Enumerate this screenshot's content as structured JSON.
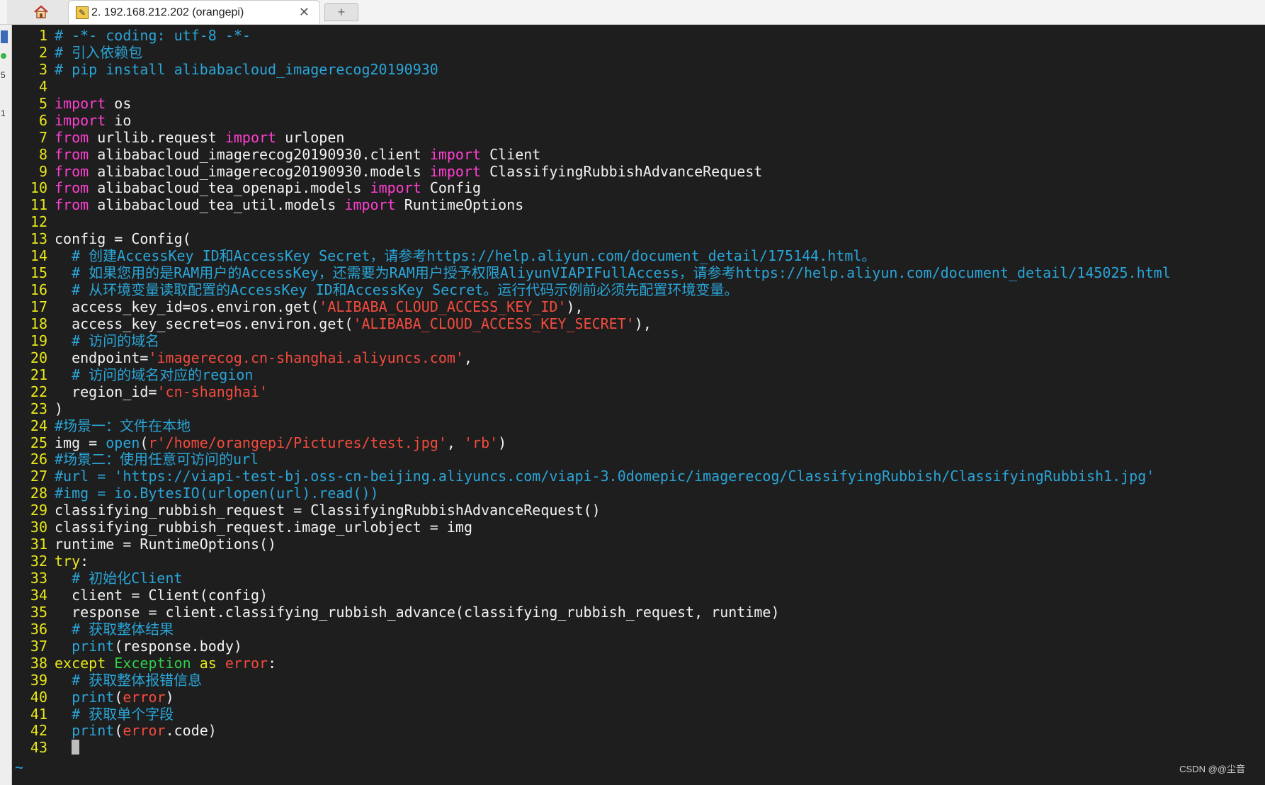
{
  "window": {
    "tab_home_icon": "home-icon",
    "tab_title": "2. 192.168.212.202 (orangepi)",
    "tab_close": "✕",
    "new_tab": "+"
  },
  "left_strip_marks": [
    "",
    "",
    "5",
    "1"
  ],
  "editor": {
    "tilde": "~",
    "watermark": "CSDN @@尘音"
  },
  "code_lines": [
    [
      {
        "t": "# -*- coding: utf-8 -*-",
        "c": "cm"
      }
    ],
    [
      {
        "t": "# 引入依赖包",
        "c": "cm"
      }
    ],
    [
      {
        "t": "# pip install alibabacloud_imagerecog20190930",
        "c": "cm"
      }
    ],
    [],
    [
      {
        "t": "import",
        "c": "kw"
      },
      {
        "t": " os"
      }
    ],
    [
      {
        "t": "import",
        "c": "kw"
      },
      {
        "t": " io"
      }
    ],
    [
      {
        "t": "from",
        "c": "kw"
      },
      {
        "t": " urllib.request "
      },
      {
        "t": "import",
        "c": "kw"
      },
      {
        "t": " urlopen"
      }
    ],
    [
      {
        "t": "from",
        "c": "kw"
      },
      {
        "t": " alibabacloud_imagerecog20190930.client "
      },
      {
        "t": "import",
        "c": "kw"
      },
      {
        "t": " Client"
      }
    ],
    [
      {
        "t": "from",
        "c": "kw"
      },
      {
        "t": " alibabacloud_imagerecog20190930.models "
      },
      {
        "t": "import",
        "c": "kw"
      },
      {
        "t": " ClassifyingRubbishAdvanceRequest"
      }
    ],
    [
      {
        "t": "from",
        "c": "kw"
      },
      {
        "t": " alibabacloud_tea_openapi.models "
      },
      {
        "t": "import",
        "c": "kw"
      },
      {
        "t": " Config"
      }
    ],
    [
      {
        "t": "from",
        "c": "kw"
      },
      {
        "t": " alibabacloud_tea_util.models "
      },
      {
        "t": "import",
        "c": "kw"
      },
      {
        "t": " RuntimeOptions"
      }
    ],
    [],
    [
      {
        "t": "config = Config("
      }
    ],
    [
      {
        "t": "  "
      },
      {
        "t": "# 创建AccessKey ID和AccessKey Secret，请参考https://help.aliyun.com/document_detail/175144.html。",
        "c": "cm"
      }
    ],
    [
      {
        "t": "  "
      },
      {
        "t": "# 如果您用的是RAM用户的AccessKey，还需要为RAM用户授予权限AliyunVIAPIFullAccess，请参考https://help.aliyun.com/document_detail/145025.html",
        "c": "cm"
      }
    ],
    [
      {
        "t": "  "
      },
      {
        "t": "# 从环境变量读取配置的AccessKey ID和AccessKey Secret。运行代码示例前必须先配置环境变量。",
        "c": "cm"
      }
    ],
    [
      {
        "t": "  access_key_id=os.environ.get("
      },
      {
        "t": "'ALIBABA_CLOUD_ACCESS_KEY_ID'",
        "c": "st"
      },
      {
        "t": "),"
      }
    ],
    [
      {
        "t": "  access_key_secret=os.environ.get("
      },
      {
        "t": "'ALIBABA_CLOUD_ACCESS_KEY_SECRET'",
        "c": "st"
      },
      {
        "t": "),"
      }
    ],
    [
      {
        "t": "  "
      },
      {
        "t": "# 访问的域名",
        "c": "cm"
      }
    ],
    [
      {
        "t": "  endpoint="
      },
      {
        "t": "'imagerecog.cn-shanghai.aliyuncs.com'",
        "c": "st"
      },
      {
        "t": ","
      }
    ],
    [
      {
        "t": "  "
      },
      {
        "t": "# 访问的域名对应的region",
        "c": "cm"
      }
    ],
    [
      {
        "t": "  region_id="
      },
      {
        "t": "'cn-shanghai'",
        "c": "st"
      }
    ],
    [
      {
        "t": ")"
      }
    ],
    [
      {
        "t": "#场景一：文件在本地",
        "c": "cm"
      }
    ],
    [
      {
        "t": "img = "
      },
      {
        "t": "open",
        "c": "fn"
      },
      {
        "t": "("
      },
      {
        "t": "r'/home/orangepi/Pictures/test.jpg'",
        "c": "st"
      },
      {
        "t": ", "
      },
      {
        "t": "'rb'",
        "c": "st"
      },
      {
        "t": ")"
      }
    ],
    [
      {
        "t": "#场景二：使用任意可访问的url",
        "c": "cm"
      }
    ],
    [
      {
        "t": "#url = 'https://viapi-test-bj.oss-cn-beijing.aliyuncs.com/viapi-3.0domepic/imagerecog/ClassifyingRubbish/ClassifyingRubbish1.jpg'",
        "c": "cm"
      }
    ],
    [
      {
        "t": "#img = io.BytesIO(urlopen(url).read())",
        "c": "cm"
      }
    ],
    [
      {
        "t": "classifying_rubbish_request = ClassifyingRubbishAdvanceRequest()"
      }
    ],
    [
      {
        "t": "classifying_rubbish_request.image_urlobject = img"
      }
    ],
    [
      {
        "t": "runtime = RuntimeOptions()"
      }
    ],
    [
      {
        "t": "try",
        "c": "tk"
      },
      {
        "t": ":"
      }
    ],
    [
      {
        "t": "  "
      },
      {
        "t": "# 初始化Client",
        "c": "cm"
      }
    ],
    [
      {
        "t": "  client = Client(config)"
      }
    ],
    [
      {
        "t": "  response = client.classifying_rubbish_advance(classifying_rubbish_request, runtime)"
      }
    ],
    [
      {
        "t": "  "
      },
      {
        "t": "# 获取整体结果",
        "c": "cm"
      }
    ],
    [
      {
        "t": "  "
      },
      {
        "t": "print",
        "c": "fn"
      },
      {
        "t": "(response.body)"
      }
    ],
    [
      {
        "t": "except",
        "c": "tk"
      },
      {
        "t": " "
      },
      {
        "t": "Exception",
        "c": "ex"
      },
      {
        "t": " "
      },
      {
        "t": "as",
        "c": "tk"
      },
      {
        "t": " "
      },
      {
        "t": "error",
        "c": "st"
      },
      {
        "t": ":"
      }
    ],
    [
      {
        "t": "  "
      },
      {
        "t": "# 获取整体报错信息",
        "c": "cm"
      }
    ],
    [
      {
        "t": "  "
      },
      {
        "t": "print",
        "c": "fn"
      },
      {
        "t": "("
      },
      {
        "t": "error",
        "c": "st"
      },
      {
        "t": ")"
      }
    ],
    [
      {
        "t": "  "
      },
      {
        "t": "# 获取单个字段",
        "c": "cm"
      }
    ],
    [
      {
        "t": "  "
      },
      {
        "t": "print",
        "c": "fn"
      },
      {
        "t": "("
      },
      {
        "t": "error",
        "c": "st"
      },
      {
        "t": ".code)"
      }
    ],
    [
      {
        "t": "  ",
        "cursor": true
      }
    ]
  ]
}
